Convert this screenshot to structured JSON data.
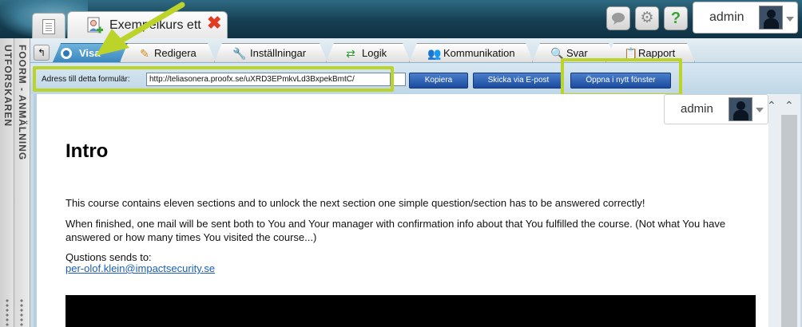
{
  "topbar": {
    "course_tab_title": "Exempelkurs ett",
    "user_name": "admin"
  },
  "sidebar": {
    "left_label": "UTFORSKAREN",
    "right_label": "FOORM - ANMÄLNING"
  },
  "tabs": [
    {
      "label": "Visa",
      "icon": "view-icon"
    },
    {
      "label": "Redigera",
      "icon": "pencil-icon"
    },
    {
      "label": "Inställningar",
      "icon": "wrench-icon"
    },
    {
      "label": "Logik",
      "icon": "logic-arrows-icon"
    },
    {
      "label": "Kommunikation",
      "icon": "people-icon"
    },
    {
      "label": "Svar",
      "icon": "magnifier-icon"
    },
    {
      "label": "Rapport",
      "icon": "clipboard-icon"
    }
  ],
  "toolbar": {
    "address_label": "Adress till detta formulär:",
    "address_value": "http://teliasonera.proofx.se/uXRD3EPmkvLd3BxpekBmtC/",
    "copy_label": "Kopiera",
    "email_label": "Skicka via E-post",
    "open_new_window_label": "Öppna i nytt fönster"
  },
  "content": {
    "user_name": "admin",
    "heading": "Intro",
    "paragraph1": "This course contains eleven sections and to unlock the next section one simple question/section has to be answered correctly!",
    "paragraph2": "When finished, one mail will be sent both to You and Your manager with confirmation info about that You fulfilled the course. (Not what You have answered or how many times You visited the course...)",
    "contact_label": "Qustions sends to:",
    "contact_email": "per-olof.klein@impactsecurity.se"
  },
  "colors": {
    "highlight": "#bcd32a",
    "active_tab": "#3a86bd",
    "button": "#1a4b9e"
  }
}
